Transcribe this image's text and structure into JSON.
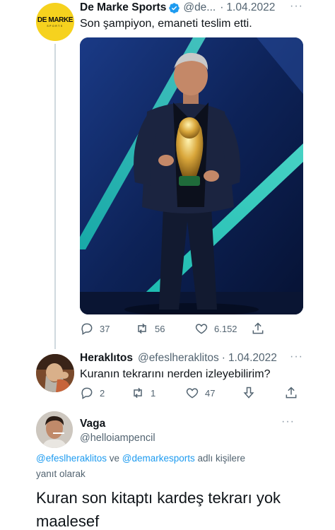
{
  "tweet1": {
    "author": "De Marke Sports",
    "handle": "@de...",
    "sep": "·",
    "date": "1.04.2022",
    "text": "Son şampiyon, emaneti teslim etti.",
    "avatar_text": "DE MARKE",
    "avatar_subtext": "SPORTS",
    "verified": true,
    "more": "···",
    "stats": {
      "replies": "37",
      "retweets": "56",
      "likes": "6.152"
    }
  },
  "tweet2": {
    "author": "Heraklıtos",
    "handle": "@efeslheraklitos",
    "sep": "·",
    "date": "1.04.2022",
    "text": "Kuranın tekrarını nerden izleyebilirim?",
    "more": "···",
    "stats": {
      "replies": "2",
      "retweets": "1",
      "likes": "47"
    }
  },
  "tweet3": {
    "author": "Vaga",
    "handle": "@helloiampencil",
    "more": "···",
    "reply_mention_1": "@efeslheraklitos",
    "reply_and": " ve ",
    "reply_mention_2": "@demarkesports",
    "reply_suffix": " adlı kişilere",
    "reply_line2": "yanıt olarak",
    "text": "Kuran son kitaptı kardeş tekrarı yok maalesef"
  },
  "colors": {
    "verified": "#1d9bf0",
    "link": "#1d9bf0",
    "secondary_text": "#536471",
    "avatar_yellow": "#f6d21e"
  },
  "icons": [
    "verified-icon",
    "reply-icon",
    "retweet-icon",
    "like-icon",
    "share-icon",
    "downvote-icon",
    "more-icon"
  ]
}
